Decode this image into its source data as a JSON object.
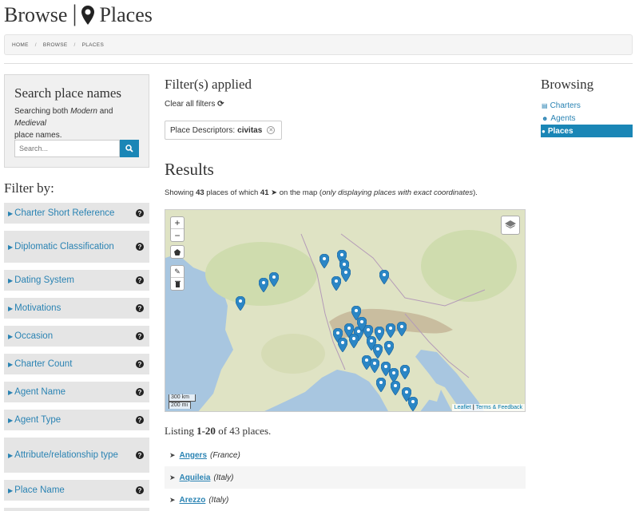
{
  "header": {
    "title_left": "Browse",
    "separator": "|",
    "title_right": "Places"
  },
  "breadcrumb": [
    "HOME",
    "BROWSE",
    "PLACES"
  ],
  "search": {
    "title": "Search place names",
    "desc_1": "Searching both ",
    "desc_modern": "Modern",
    "desc_and": " and ",
    "desc_medieval": "Medieval",
    "desc_2": "place names.",
    "placeholder": "Search..."
  },
  "filters": {
    "title": "Filter by:",
    "items": [
      "Charter Short Reference",
      "Diplomatic Classification",
      "Dating System",
      "Motivations",
      "Occasion",
      "Charter Count",
      "Agent Name",
      "Agent Type",
      "Attribute/relationship type",
      "Place Name",
      ""
    ]
  },
  "applied": {
    "title": "Filter(s) applied",
    "clear_label": "Clear all filters",
    "chip_key": "Place Descriptors:",
    "chip_value": "civitas"
  },
  "results": {
    "title": "Results",
    "showing_1": "Showing ",
    "total": "43",
    "showing_2": " places of which ",
    "on_map": "41",
    "showing_3": " on the map (",
    "showing_note": "only displaying places with exact coordinates",
    "showing_4": ")."
  },
  "map": {
    "zoom_in": "+",
    "zoom_out": "−",
    "scale_km": "300 km",
    "scale_mi": "200 mi",
    "attrib_leaflet": "Leaflet",
    "attrib_sep": " | ",
    "attrib_terms": "Terms & Feedback",
    "marker_color": "#2b86c5"
  },
  "listing": {
    "prefix": "Listing ",
    "range": "1-20",
    "suffix": " of 43 places.",
    "places": [
      {
        "name": "Angers",
        "country": "(France)"
      },
      {
        "name": "Aquileia",
        "country": "(Italy)"
      },
      {
        "name": "Arezzo",
        "country": "(Italy)"
      }
    ]
  },
  "browsing": {
    "title": "Browsing",
    "items": [
      "Charters",
      "Agents",
      "Places"
    ],
    "active": "Places"
  }
}
